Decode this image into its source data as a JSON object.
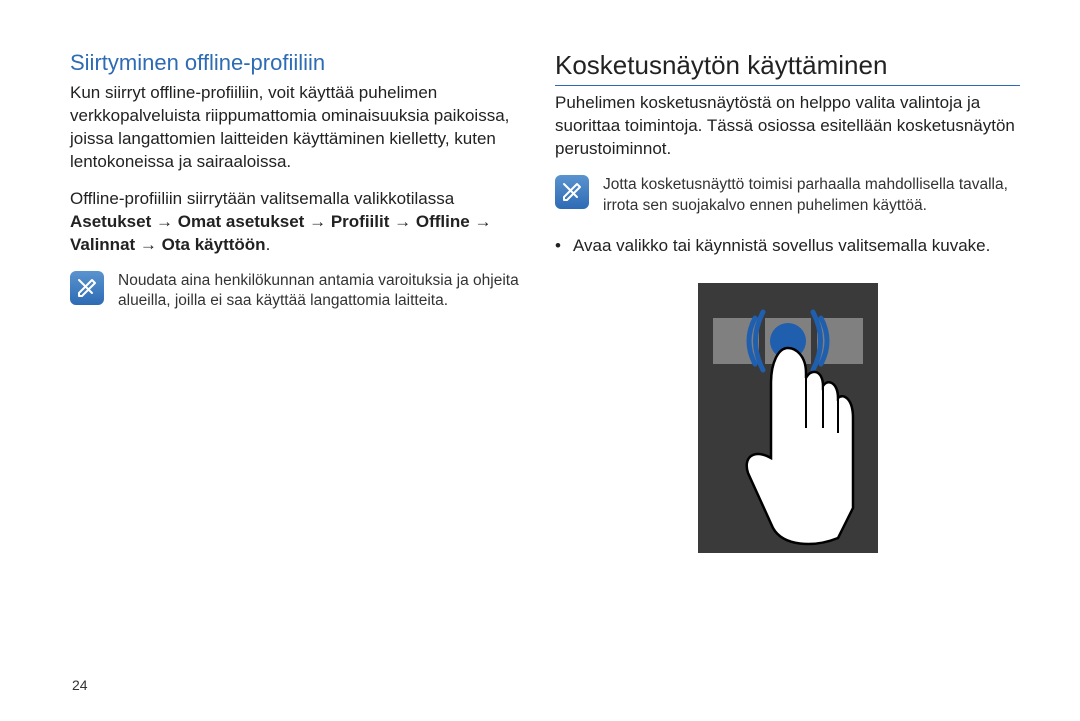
{
  "left": {
    "subheading": "Siirtyminen offline-profiiliin",
    "para1": "Kun siirryt offline-profiiliin, voit käyttää puhelimen verkkopalveluista riippumattomia ominaisuuksia paikoissa, joissa langattomien laitteiden käyttäminen kielletty, kuten lentokoneissa ja sairaaloissa.",
    "para2_lead": "Offline-profiiliin siirrytään valitsemalla valikkotilassa ",
    "para2_s1": "Asetukset",
    "para2_s2": "Omat asetukset",
    "para2_s3": "Profiilit",
    "para2_s4": "Offline",
    "para2_s5": "Valinnat",
    "para2_s6": "Ota käyttöön",
    "note": "Noudata aina henkilökunnan antamia varoituksia ja ohjeita alueilla, joilla ei saa käyttää langattomia laitteita."
  },
  "right": {
    "heading": "Kosketusnäytön käyttäminen",
    "para1": "Puhelimen kosketusnäytöstä on helppo valita valintoja ja suorittaa toimintoja. Tässä osiossa esitellään kosketusnäytön perustoiminnot.",
    "note": "Jotta kosketusnäyttö toimisi parhaalla mahdollisella tavalla, irrota sen suojakalvo ennen puhelimen käyttöä.",
    "bullet1": "Avaa valikko tai käynnistä sovellus valitsemalla kuvake."
  },
  "page_number": "24"
}
